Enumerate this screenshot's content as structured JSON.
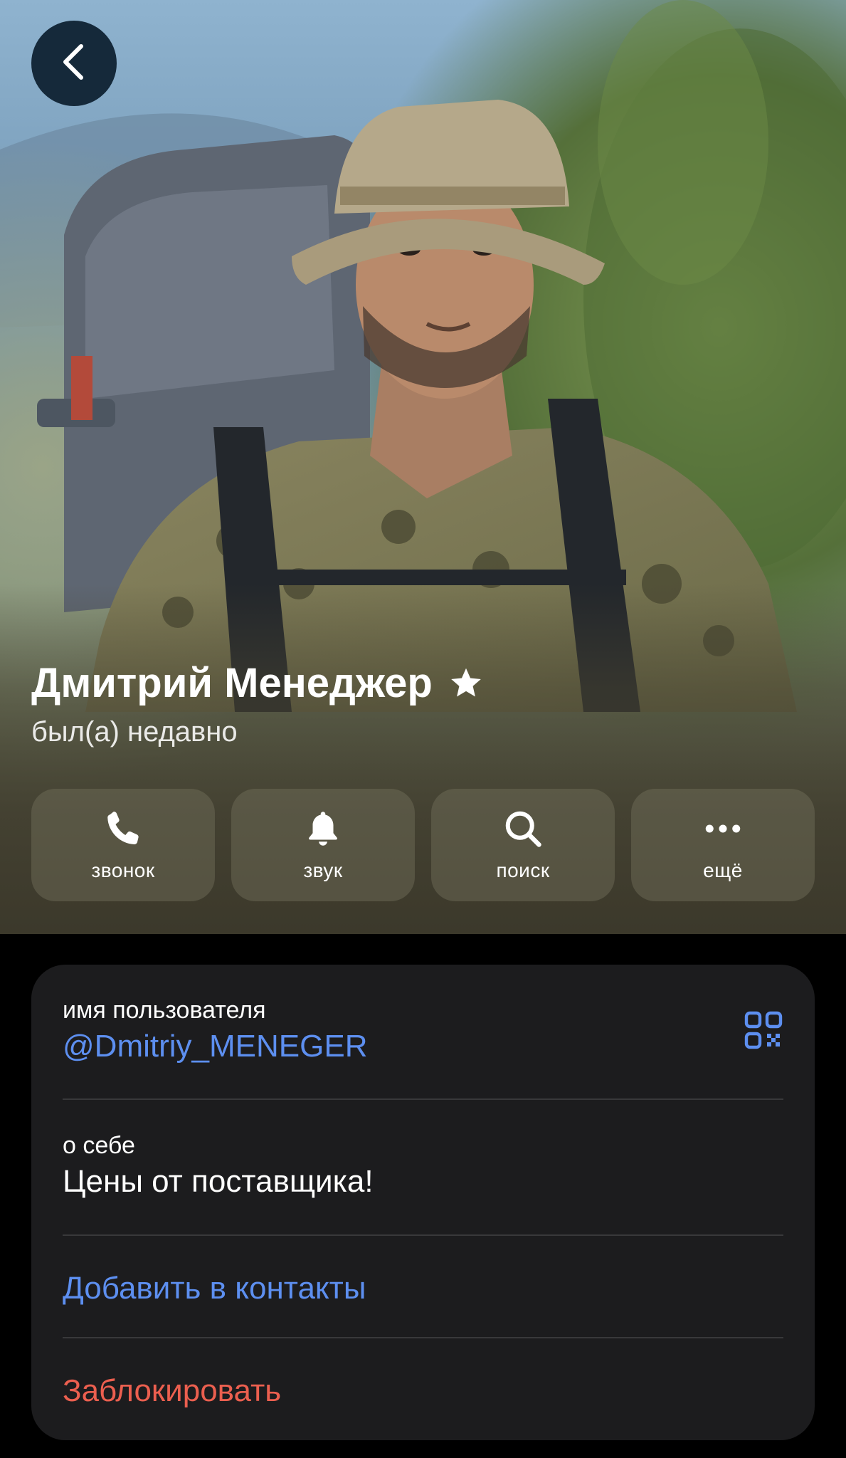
{
  "header": {
    "back_icon": "chevron-left-icon"
  },
  "profile": {
    "name": "Дмитрий Менеджер",
    "badge_icon": "star-icon",
    "status": "был(а) недавно"
  },
  "actions": [
    {
      "id": "call",
      "label": "звонок",
      "icon": "phone-icon"
    },
    {
      "id": "sound",
      "label": "звук",
      "icon": "bell-icon"
    },
    {
      "id": "search",
      "label": "поиск",
      "icon": "search-icon"
    },
    {
      "id": "more",
      "label": "ещё",
      "icon": "more-dots-icon"
    }
  ],
  "info": {
    "username_caption": "имя пользователя",
    "username": "@Dmitriy_MENEGER",
    "qr_icon": "qr-code-icon",
    "about_caption": "о себе",
    "about": "Цены от поставщика!",
    "add_contact": "Добавить в контакты",
    "block": "Заблокировать"
  },
  "colors": {
    "link": "#5d8ff0",
    "danger": "#eb5f4f",
    "card_bg": "#1c1c1e",
    "page_bg": "#000000",
    "back_button_bg": "#15293a"
  }
}
